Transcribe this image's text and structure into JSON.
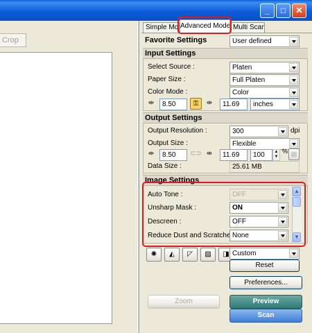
{
  "window": {
    "minimize": "_",
    "maximize": "□",
    "close": "✕"
  },
  "leftpane": {
    "crop_label": "Crop"
  },
  "tabs": [
    {
      "label": "Simple Mode"
    },
    {
      "label": "Advanced Mode"
    },
    {
      "label": "Multi Scan"
    }
  ],
  "favorite": {
    "title": "Favorite Settings",
    "value": "User defined"
  },
  "input": {
    "title": "Input Settings",
    "source_label": "Select Source :",
    "source_value": "Platen",
    "paper_label": "Paper Size :",
    "paper_value": "Full Platen",
    "color_label": "Color Mode :",
    "color_value": "Color",
    "width": "8.50",
    "height": "11.69",
    "unit": "inches"
  },
  "output": {
    "title": "Output Settings",
    "resolution_label": "Output Resolution :",
    "resolution_value": "300",
    "resolution_unit": "dpi",
    "size_label": "Output Size :",
    "size_value": "Flexible",
    "width": "8.50",
    "height": "11.69",
    "percent": "100",
    "percent_unit": "%",
    "datasize_label": "Data Size :",
    "datasize_value": "25.61 MB"
  },
  "image": {
    "title": "Image Settings",
    "autotone_label": "Auto Tone :",
    "autotone_value": "OFF",
    "unsharp_label": "Unsharp Mask :",
    "unsharp_value": "ON",
    "descreen_label": "Descreen :",
    "descreen_value": "OFF",
    "dust_label": "Reduce Dust and Scratches :",
    "dust_value": "None"
  },
  "tools": {
    "preset_value": "Custom",
    "reset_label": "Reset"
  },
  "buttons": {
    "preferences": "Preferences...",
    "zoom": "Zoom",
    "preview": "Preview",
    "scan": "Scan"
  },
  "colors": {
    "highlight": "#e0191d",
    "preview_button": "#2f7d78",
    "scan_button": "#3e7fd8"
  }
}
